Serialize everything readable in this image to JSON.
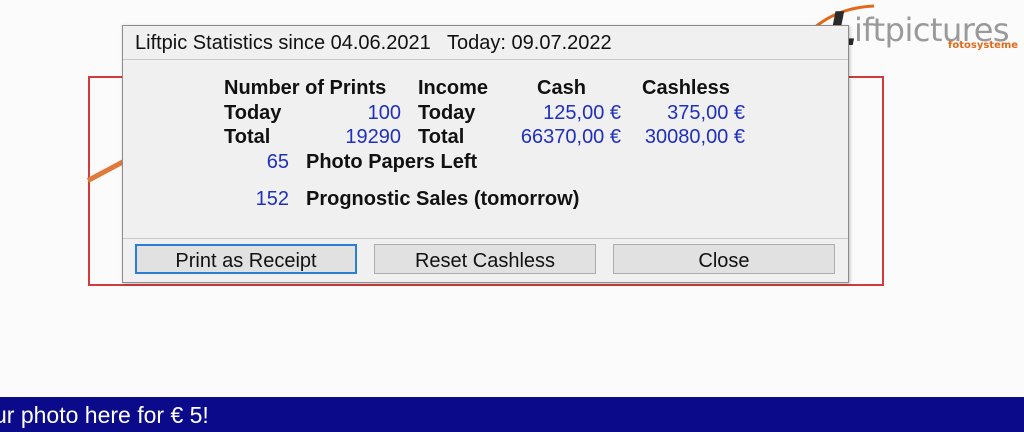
{
  "logo": {
    "wordmark_initial": "L",
    "wordmark_rest": "iftpictures",
    "subtitle": "fotosysteme",
    "accent_color": "#e06a1a"
  },
  "dialog": {
    "title": "Liftpic Statistics since 04.06.2021   Today: 09.07.2022",
    "headers": {
      "prints": "Number of Prints",
      "income": "Income",
      "cash": "Cash",
      "cashless": "Cashless"
    },
    "rows": {
      "today_label": "Today",
      "today_prints": "100",
      "today_income_label": "Today",
      "today_cash": "125,00 €",
      "today_cashless": "375,00 €",
      "total_label": "Total",
      "total_prints": "19290",
      "total_income_label": "Total",
      "total_cash": "66370,00 €",
      "total_cashless": "30080,00 €"
    },
    "papers_left_value": "65",
    "papers_left_label": "Photo Papers Left",
    "prognostic_value": "152",
    "prognostic_label": "Prognostic Sales (tomorrow)",
    "buttons": {
      "print_receipt": "Print as Receipt",
      "reset_cashless": "Reset Cashless",
      "close": "Close"
    },
    "value_color": "#1f2fbf"
  },
  "ticker": {
    "text": "ur photo here for € 5!",
    "background": "#0a0a8a"
  }
}
